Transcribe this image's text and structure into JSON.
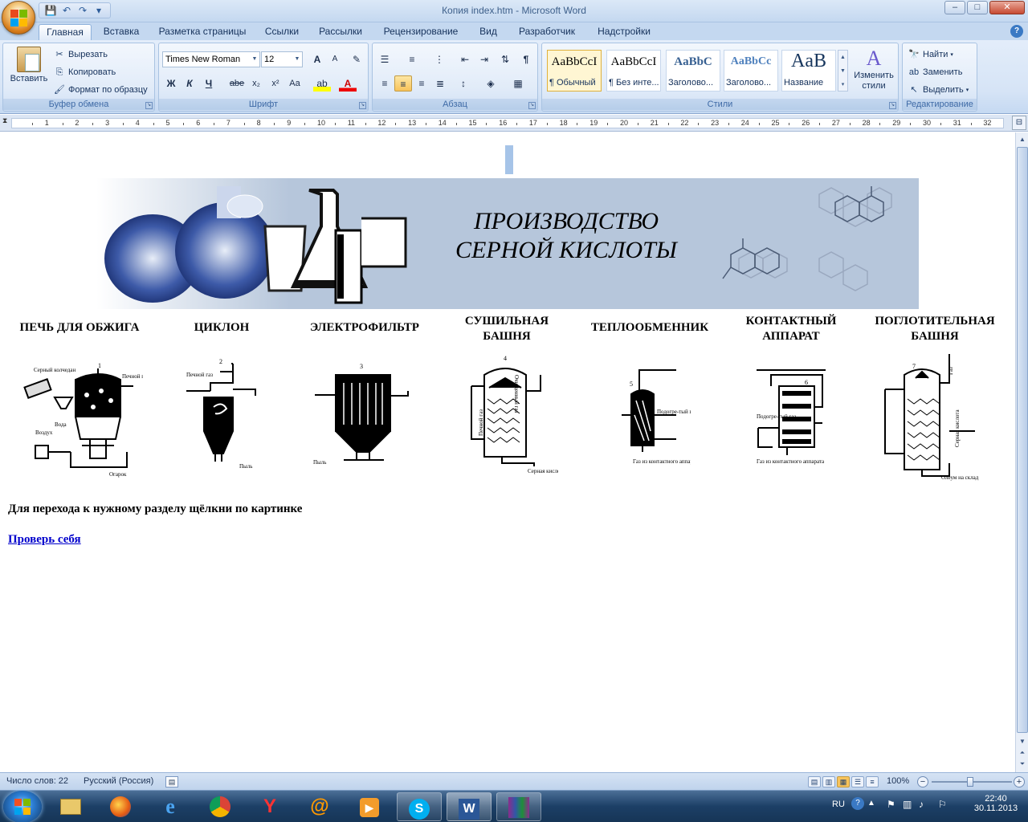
{
  "window": {
    "title": "Копия index.htm - Microsoft Word",
    "controls": {
      "minimize": "–",
      "maximize": "□",
      "close": "✕"
    }
  },
  "qat": {
    "icons": [
      "save-icon",
      "undo-icon",
      "redo-icon",
      "customize-icon"
    ]
  },
  "tabs": [
    "Главная",
    "Вставка",
    "Разметка страницы",
    "Ссылки",
    "Рассылки",
    "Рецензирование",
    "Вид",
    "Разработчик",
    "Надстройки"
  ],
  "ribbon": {
    "clipboard": {
      "label": "Буфер обмена",
      "paste": "Вставить",
      "cut": "Вырезать",
      "copy": "Копировать",
      "format_painter": "Формат по образцу"
    },
    "font": {
      "label": "Шрифт",
      "family": "Times New Roman",
      "size": "12",
      "bold": "Ж",
      "italic": "К",
      "underline": "Ч",
      "strike": "abe",
      "sub": "x₂",
      "sup": "x²",
      "case": "Aa",
      "grow": "A",
      "shrink": "A"
    },
    "paragraph": {
      "label": "Абзац"
    },
    "styles": {
      "label": "Стили",
      "items": [
        {
          "sample": "AaBbCcI",
          "name": "¶ Обычный"
        },
        {
          "sample": "AaBbCcI",
          "name": "¶ Без инте..."
        },
        {
          "sample": "AaBbC",
          "name": "Заголово..."
        },
        {
          "sample": "AaBbCc",
          "name": "Заголово..."
        },
        {
          "sample": "AaB",
          "name": "Название"
        }
      ],
      "change": "Изменить стили"
    },
    "editing": {
      "label": "Редактирование",
      "find": "Найти",
      "replace": "Заменить",
      "select": "Выделить"
    }
  },
  "ruler": {
    "ticks": [
      "1",
      "2",
      "3",
      "4",
      "5",
      "6",
      "7",
      "8",
      "9",
      "10",
      "11",
      "12",
      "13",
      "14",
      "15",
      "16",
      "17",
      "18",
      "19",
      "20",
      "21",
      "22",
      "23",
      "24",
      "25",
      "26",
      "27",
      "28",
      "29",
      "30",
      "31",
      "32"
    ]
  },
  "document": {
    "banner_title_line1": "ПРОИЗВОДСТВО",
    "banner_title_line2": "СЕРНОЙ КИСЛОТЫ",
    "equipment": [
      {
        "label": "ПЕЧЬ ДЛЯ ОБЖИГА",
        "num": "1",
        "notes": [
          "Серный колчедан",
          "Печной газ",
          "Вода",
          "Воздух",
          "Огарок"
        ]
      },
      {
        "label": "ЦИКЛОН",
        "num": "2",
        "notes": [
          "Печной газ",
          "Пыль"
        ]
      },
      {
        "label": "ЭЛЕКТРОФИЛЬТР",
        "num": "3",
        "notes": [
          "Пыль"
        ]
      },
      {
        "label": "СУШИЛЬНАЯ БАШНЯ",
        "num": "4",
        "notes": [
          "Печной газ",
          "Очищенный газ",
          "Серная кислота"
        ]
      },
      {
        "label": "ТЕПЛООБМЕННИК",
        "num": "5",
        "notes": [
          "Подогре-тый газ",
          "Газ из контактного аппарата"
        ]
      },
      {
        "label": "КОНТАКТНЫЙ АППАРАТ",
        "num": "6",
        "notes": [
          "Подогре-тый газ",
          "Газ из контактного аппарата"
        ]
      },
      {
        "label": "ПОГЛОТИТЕЛЬНАЯ БАШНЯ",
        "num": "7",
        "notes": [
          "Газ",
          "Серная кислота",
          "Олеум на склад"
        ]
      }
    ],
    "instruction": "Для перехода к нужному разделу щёлкни по картинке",
    "check_link": "Проверь себя"
  },
  "status": {
    "words": "Число слов: 22",
    "language": "Русский (Россия)",
    "zoom": "100%"
  },
  "taskbar": {
    "tray_lang": "RU",
    "time": "22:40",
    "date": "30.11.2013"
  },
  "colors": {
    "ribbon_bg": "#d6e4f6",
    "banner_bg": "#b6c6db",
    "link": "#0000cc",
    "selected_button": "#f8c35a"
  }
}
